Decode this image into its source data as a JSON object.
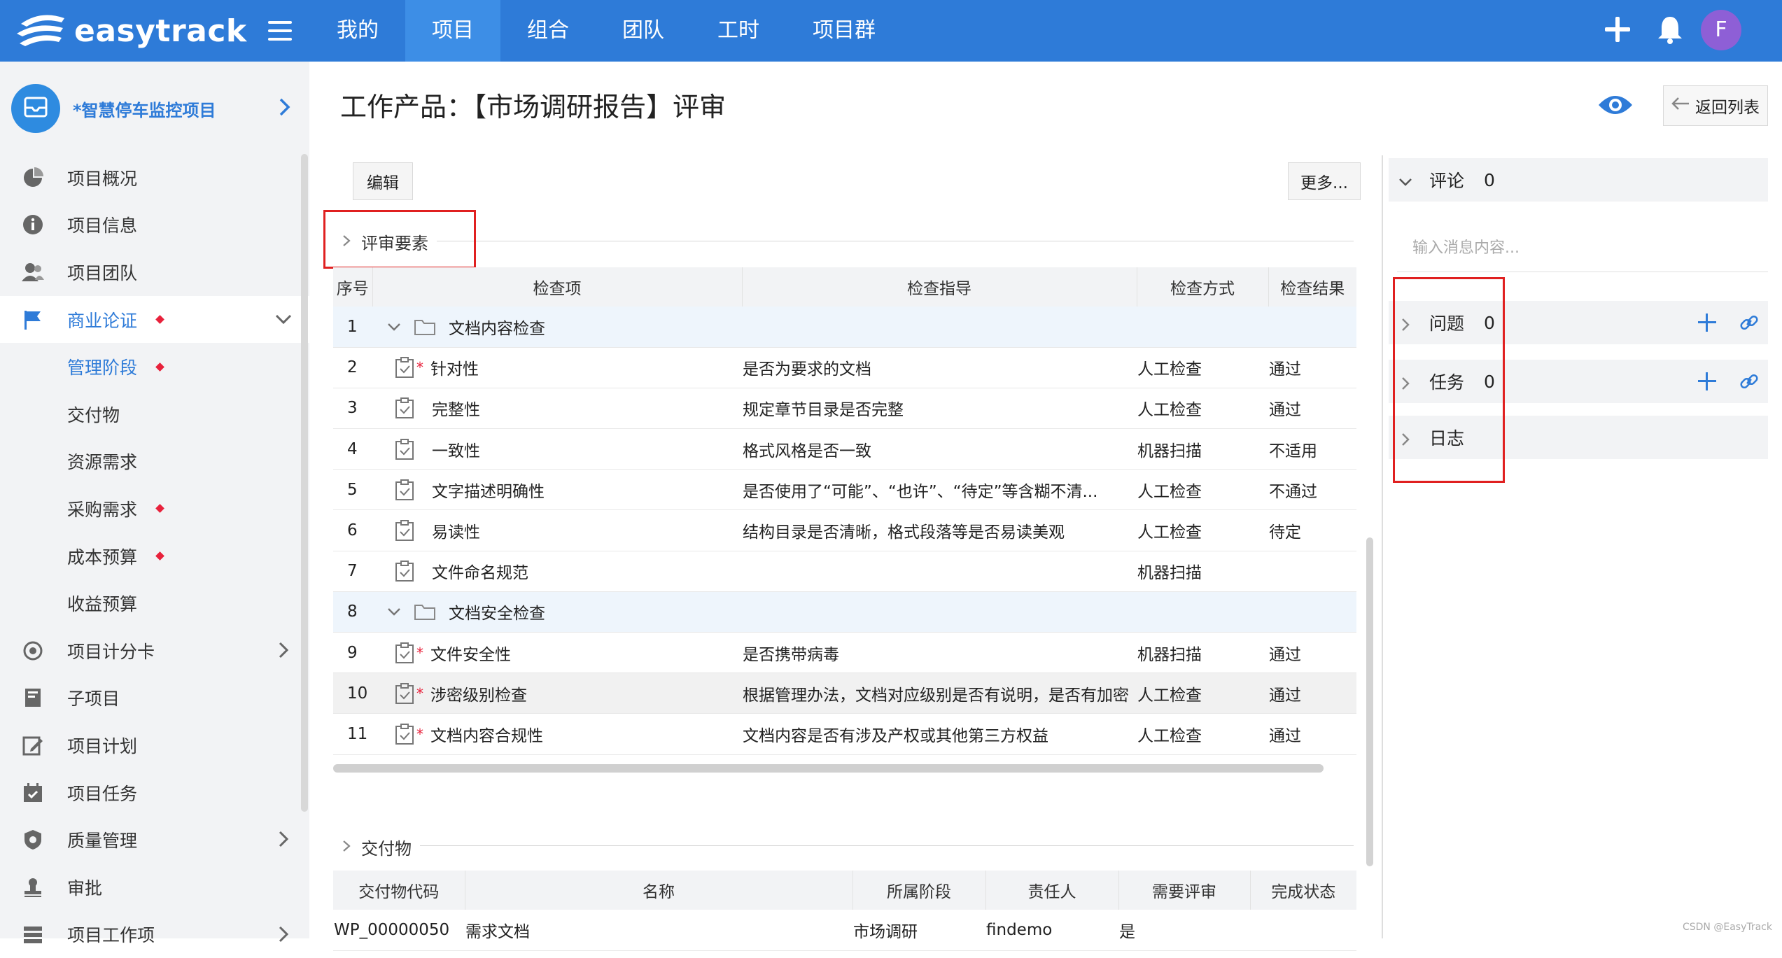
{
  "app": {
    "brand": "easytrack",
    "nav": [
      "我的",
      "项目",
      "组合",
      "团队",
      "工时",
      "项目群"
    ],
    "nav_active_index": 1,
    "avatar_letter": "F",
    "accent_color": "#2e7bd8"
  },
  "sidebar": {
    "project_name": "*智慧停车监控项目",
    "items": [
      {
        "label": "项目概况",
        "icon": "pie-chart-icon"
      },
      {
        "label": "项目信息",
        "icon": "info-icon"
      },
      {
        "label": "项目团队",
        "icon": "team-icon"
      },
      {
        "label": "商业论证",
        "icon": "flag-icon",
        "active": true,
        "dot": true,
        "chevron": "down"
      },
      {
        "label": "管理阶段",
        "sub": true,
        "active": true,
        "dot": true
      },
      {
        "label": "交付物",
        "sub": true
      },
      {
        "label": "资源需求",
        "sub": true
      },
      {
        "label": "采购需求",
        "sub": true,
        "dot": true
      },
      {
        "label": "成本预算",
        "sub": true,
        "dot": true
      },
      {
        "label": "收益预算",
        "sub": true
      },
      {
        "label": "项目计分卡",
        "icon": "target-icon",
        "chevron": "right"
      },
      {
        "label": "子项目",
        "icon": "subproject-icon"
      },
      {
        "label": "项目计划",
        "icon": "plan-icon"
      },
      {
        "label": "项目任务",
        "icon": "calendar-check-icon"
      },
      {
        "label": "质量管理",
        "icon": "shield-icon",
        "chevron": "right"
      },
      {
        "label": "审批",
        "icon": "stamp-icon"
      },
      {
        "label": "项目工作项",
        "icon": "list-icon",
        "chevron": "right"
      }
    ]
  },
  "main": {
    "title": "工作产品：【市场调研报告】评审",
    "back_label": "返回列表",
    "edit_label": "编辑",
    "more_label": "更多...",
    "review_section": "评审要素",
    "review_columns": [
      "序号",
      "检查项",
      "检查指导",
      "检查方式",
      "检查结果"
    ],
    "review_rows": [
      {
        "no": "1",
        "name": "文档内容检查",
        "group": true
      },
      {
        "no": "2",
        "name": "针对性",
        "required": true,
        "guide": "是否为要求的文档",
        "method": "人工检查",
        "result": "通过"
      },
      {
        "no": "3",
        "name": "完整性",
        "guide": "规定章节目录是否完整",
        "method": "人工检查",
        "result": "通过"
      },
      {
        "no": "4",
        "name": "一致性",
        "guide": "格式风格是否一致",
        "method": "机器扫描",
        "result": "不适用"
      },
      {
        "no": "5",
        "name": "文字描述明确性",
        "guide": "是否使用了“可能”、“也许”、“待定”等含糊不清...",
        "method": "人工检查",
        "result": "不通过"
      },
      {
        "no": "6",
        "name": "易读性",
        "guide": "结构目录是否清晰，格式段落等是否易读美观",
        "method": "人工检查",
        "result": "待定"
      },
      {
        "no": "7",
        "name": "文件命名规范",
        "guide": "",
        "method": "机器扫描",
        "result": ""
      },
      {
        "no": "8",
        "name": "文档安全检查",
        "group": true
      },
      {
        "no": "9",
        "name": "文件安全性",
        "required": true,
        "guide": "是否携带病毒",
        "method": "机器扫描",
        "result": "通过"
      },
      {
        "no": "10",
        "name": "涉密级别检查",
        "required": true,
        "guide": "根据管理办法，文档对应级别是否有说明，是否有加密",
        "method": "人工检查",
        "result": "通过",
        "highlight": true
      },
      {
        "no": "11",
        "name": "文档内容合规性",
        "required": true,
        "guide": "文档内容是否有涉及产权或其他第三方权益",
        "method": "人工检查",
        "result": "通过"
      }
    ],
    "deliverable_section": "交付物",
    "deliverable_columns": [
      "交付物代码",
      "名称",
      "所属阶段",
      "责任人",
      "需要评审",
      "完成状态"
    ],
    "deliverable_rows": [
      {
        "code": "WP_00000050",
        "name": "需求文档",
        "stage": "市场调研",
        "owner": "findemo",
        "need_review": "是",
        "status": ""
      }
    ]
  },
  "right_panel": {
    "comment_label": "评论",
    "comment_count": "0",
    "input_placeholder": "输入消息内容...",
    "issue_label": "问题",
    "issue_count": "0",
    "task_label": "任务",
    "task_count": "0",
    "log_label": "日志"
  },
  "watermark": "CSDN @EasyTrack"
}
